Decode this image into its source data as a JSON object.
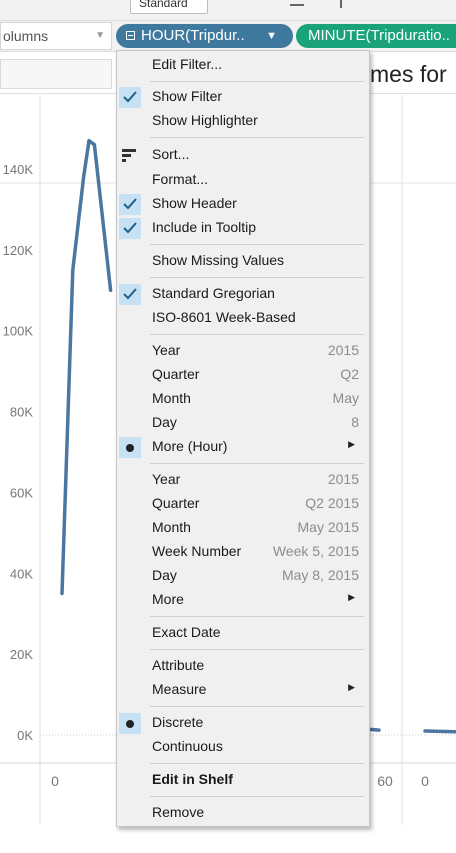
{
  "toolbar": {
    "standard_label": "Standard"
  },
  "shelf": {
    "columns_label": "olumns",
    "pill_hour": "HOUR(Tripdur..",
    "pill_minute": "MINUTE(Tripduratio.."
  },
  "title_fragment": "mes for",
  "chart_data": {
    "type": "line",
    "y_tick_labels": [
      "140K",
      "120K",
      "100K",
      "80K",
      "60K",
      "40K",
      "20K",
      "0K"
    ],
    "x_tick_labels": [
      "0",
      "60",
      "0"
    ],
    "series": [
      {
        "x": [
          0,
          2,
          4,
          5,
          6,
          9
        ],
        "values": [
          35000,
          115000,
          138000,
          147000,
          146000,
          110000
        ]
      },
      {
        "x": [
          55,
          58
        ],
        "values": [
          1500,
          1200
        ]
      },
      {
        "x": [
          0,
          3
        ],
        "values": [
          1000,
          800
        ]
      }
    ],
    "line_color": "#4a76a0",
    "ylim": [
      0,
      150000
    ],
    "grid": true
  },
  "menu": {
    "edit_filter": "Edit Filter...",
    "show_filter": "Show Filter",
    "show_highlighter": "Show Highlighter",
    "sort": "Sort...",
    "format": "Format...",
    "show_header": "Show Header",
    "include_tooltip": "Include in Tooltip",
    "show_missing": "Show Missing Values",
    "standard_gregorian": "Standard Gregorian",
    "iso_week": "ISO-8601 Week-Based",
    "date_parts": [
      {
        "label": "Year",
        "value": "2015"
      },
      {
        "label": "Quarter",
        "value": "Q2"
      },
      {
        "label": "Month",
        "value": "May"
      },
      {
        "label": "Day",
        "value": "8"
      }
    ],
    "more_hour": "More (Hour)",
    "date_values": [
      {
        "label": "Year",
        "value": "2015"
      },
      {
        "label": "Quarter",
        "value": "Q2 2015"
      },
      {
        "label": "Month",
        "value": "May 2015"
      },
      {
        "label": "Week Number",
        "value": "Week 5, 2015"
      },
      {
        "label": "Day",
        "value": "May 8, 2015"
      }
    ],
    "more": "More",
    "exact_date": "Exact Date",
    "attribute": "Attribute",
    "measure": "Measure",
    "discrete": "Discrete",
    "continuous": "Continuous",
    "edit_in_shelf": "Edit in Shelf",
    "remove": "Remove"
  }
}
